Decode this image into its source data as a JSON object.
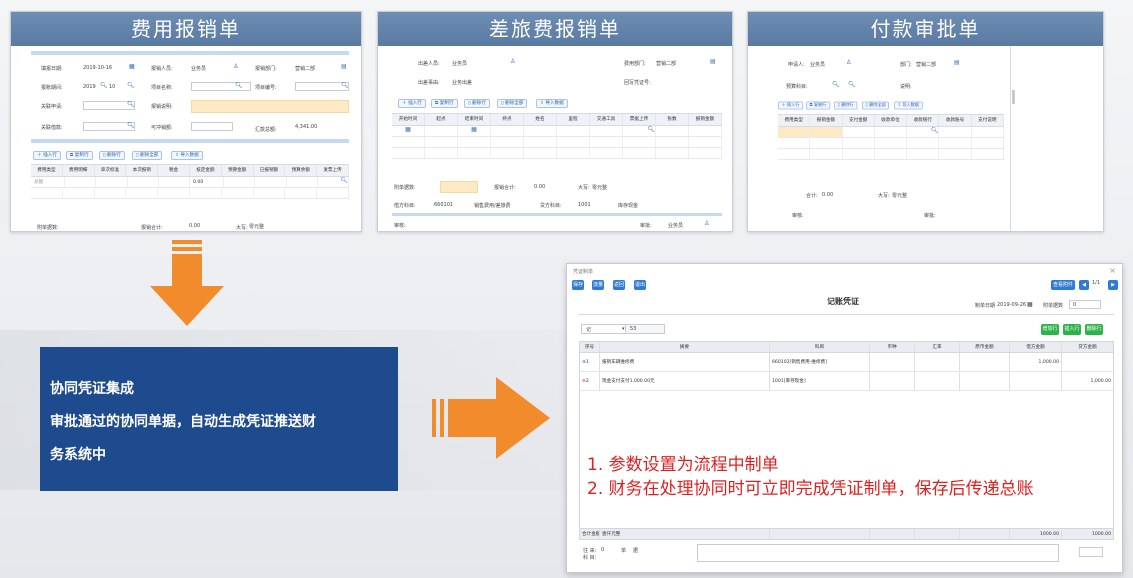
{
  "panels": {
    "expense": {
      "title": "费用报销单",
      "f": {
        "fill_date_label": "填报日期:",
        "fill_date": "2019-10-16",
        "reimburser_label": "报销人员:",
        "reimburser": "业务员",
        "dept_label": "报销部门:",
        "dept": "营销二部",
        "period_label": "报账期间:",
        "period_year": "2019",
        "period_num": "10",
        "project_label": "项目名称:",
        "item_label": "项目编号:",
        "related_req_label": "关联申请:",
        "desc_label": "报销说明:",
        "related_loan_label": "关联借款:",
        "offset_label": "可冲销额:",
        "total_label": "汇款总额:",
        "total": "4,341.00"
      },
      "toolbar": [
        "插入行",
        "复制行",
        "删除行",
        "删除全部",
        "导入数据"
      ],
      "cols": [
        "费用类型",
        "费用明细",
        "单次标准",
        "本次报销",
        "税金",
        "核定金额",
        "预算金额",
        "已报销额",
        "预算余额",
        "发票上传"
      ],
      "row_type": "总额",
      "row_amount": "0.00",
      "footer": {
        "attach_label": "附单据数:",
        "sum_label": "报销合计:",
        "sum": "0.00",
        "upper_label": "大写:",
        "upper": "零元整"
      }
    },
    "travel": {
      "title": "差旅费报销单",
      "f": {
        "traveler_label": "出差人员:",
        "traveler": "业务员",
        "dept_label": "费用部门:",
        "dept": "营销二部",
        "reason_label": "出差事由:",
        "reason": "业务出差",
        "voucher_label": "回写凭证号:"
      },
      "toolbar": [
        "插入行",
        "复制行",
        "删除行",
        "删除全部",
        "导入数据"
      ],
      "cols": [
        "开始时间",
        "起点",
        "结束时间",
        "终点",
        "姓名",
        "里程",
        "交通工具",
        "票据上传",
        "张数",
        "报销金额"
      ],
      "footer": {
        "attach_label": "附单据数:",
        "sum_label": "报销合计:",
        "sum": "0.00",
        "upper_label": "大写:",
        "upper": "零元整",
        "debit_label": "借方科目:",
        "debit_code": "660101",
        "debit_name": "销售费用/差旅费",
        "credit_label": "贷方科目:",
        "credit_code": "1001",
        "credit_name": "库存现金",
        "audit_label": "审核:",
        "approve_label": "审批:",
        "approver": "业务员"
      }
    },
    "payment": {
      "title": "付款审批单",
      "f": {
        "applicant_label": "申请人:",
        "applicant": "业务员",
        "dept_label": "部门:",
        "dept": "营销二部",
        "amount_label": "预算科目:",
        "desc_label": "说明:"
      },
      "toolbar": [
        "插入行",
        "复制行",
        "删除行",
        "删除全部",
        "导入数据"
      ],
      "cols": [
        "费用类型",
        "报销金额",
        "支付金额",
        "收款单位",
        "收款银行",
        "收款账号",
        "支付说明"
      ],
      "footer": {
        "total_label": "合计:",
        "total": "0.00",
        "upper_label": "大写:",
        "upper": "零元整",
        "audit_label": "审核:",
        "approve_label": "审批:"
      }
    }
  },
  "bluebox": {
    "line1": "协同凭证集成",
    "line2": "审批通过的协同单据，自动生成凭证推送财",
    "line3": "务系统中"
  },
  "voucher": {
    "titlebar": "凭证制单",
    "buttons": [
      "保存",
      "流量",
      "返回",
      "退出"
    ],
    "top_right": {
      "query": "查看附件",
      "page": "1/1"
    },
    "title": "记账凭证",
    "meta": {
      "date_label": "制单日期",
      "date": "2019-09-26",
      "attach_label": "附单据数",
      "attach": "0"
    },
    "type": "记",
    "number": "53",
    "row_buttons": [
      "增加行",
      "插入行",
      "删除行"
    ],
    "cols": [
      "序号",
      "摘要",
      "科目",
      "币种",
      "汇率",
      "原币金额",
      "借方金额",
      "贷方金额"
    ],
    "rows": [
      {
        "no": "1",
        "summary": "报销车辆维修费",
        "subject": "660102[销售费用-维修费]",
        "debit": "1,000.00",
        "credit": ""
      },
      {
        "no": "2",
        "summary": "现金支付支付1,000.00元",
        "subject": "1001[库存现金]",
        "debit": "",
        "credit": "1,000.00"
      }
    ],
    "note1": "1. 参数设置为流程中制单",
    "note2": "2. 财务在处理协同时可立即完成凭证制单，保存后传递总账",
    "footer": {
      "total_label": "合计金额",
      "total_upper": "壹仟元整",
      "debit_total": "1000.00",
      "credit_total": "1000.00",
      "bottom1": "往 来:",
      "bottom1_val": "0",
      "bottom2": "单",
      "bottom3": "据",
      "bottom4": "科 目:"
    }
  },
  "colors": {
    "title_blue": "#5a7aa3",
    "box_blue": "#1e4a8e",
    "arrow_orange": "#f28b2c",
    "note_red": "#e02020",
    "btn_blue": "#2e7bd6",
    "btn_green": "#2eb24a"
  }
}
